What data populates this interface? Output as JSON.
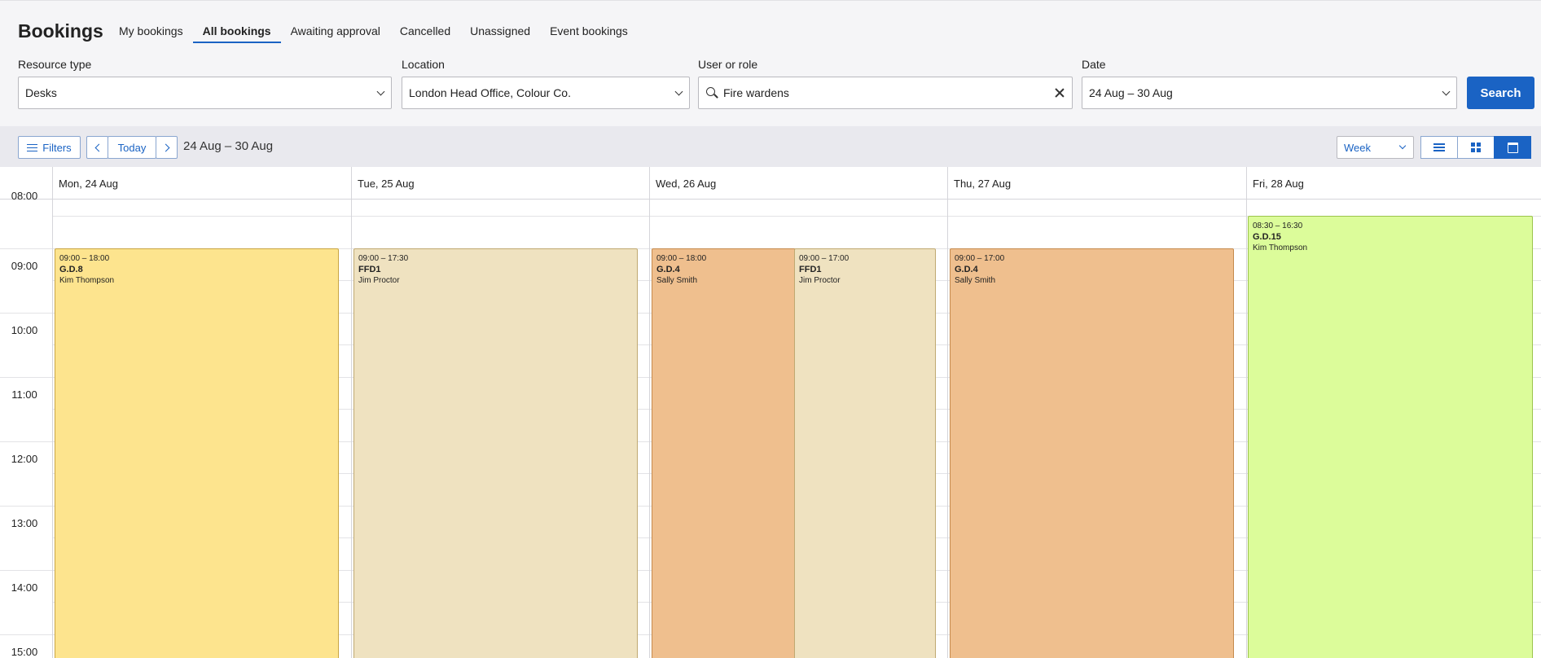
{
  "header": {
    "title": "Bookings",
    "tabs": [
      {
        "label": "My bookings",
        "active": false
      },
      {
        "label": "All bookings",
        "active": true
      },
      {
        "label": "Awaiting approval",
        "active": false
      },
      {
        "label": "Cancelled",
        "active": false
      },
      {
        "label": "Unassigned",
        "active": false
      },
      {
        "label": "Event bookings",
        "active": false
      }
    ]
  },
  "filters": {
    "resource_type": {
      "label": "Resource type",
      "value": "Desks"
    },
    "location": {
      "label": "Location",
      "value": "London Head Office, Colour Co."
    },
    "user_or_role": {
      "label": "User or role",
      "value": "Fire wardens"
    },
    "date": {
      "label": "Date",
      "value": "24 Aug – 30 Aug"
    },
    "search_label": "Search"
  },
  "toolbar": {
    "filters_label": "Filters",
    "today_label": "Today",
    "range": "24 Aug – 30 Aug",
    "view_select": "Week",
    "active_view": "calendar"
  },
  "calendar": {
    "days": [
      "Mon, 24 Aug",
      "Tue, 25 Aug",
      "Wed, 26 Aug",
      "Thu, 27 Aug",
      "Fri, 28 Aug"
    ],
    "hours": [
      "09:00",
      "10:00",
      "11:00",
      "12:00",
      "13:00",
      "14:00",
      "15:00"
    ],
    "top_partial_hour": "08:00",
    "events": [
      {
        "time": "09:00 – 18:00",
        "resource": "G.D.8",
        "user": "Kim Thompson",
        "color": "#fde48e",
        "border": "#c9a542"
      },
      {
        "time": "09:00 – 17:30",
        "resource": "FFD1",
        "user": "Jim Proctor",
        "color": "#efe2c0",
        "border": "#c0a971"
      },
      {
        "time": "09:00 – 18:00",
        "resource": "G.D.4",
        "user": "Sally Smith",
        "color": "#efbf8e",
        "border": "#c68a4d"
      },
      {
        "time": "09:00 – 17:00",
        "resource": "FFD1",
        "user": "Jim Proctor",
        "color": "#efe2c0",
        "border": "#c0a971"
      },
      {
        "time": "09:00 – 17:00",
        "resource": "G.D.4",
        "user": "Sally Smith",
        "color": "#efbf8e",
        "border": "#c68a4d"
      },
      {
        "time": "08:30 – 16:30",
        "resource": "G.D.15",
        "user": "Kim Thompson",
        "color": "#dcfc9a",
        "border": "#9bc44c"
      }
    ]
  }
}
